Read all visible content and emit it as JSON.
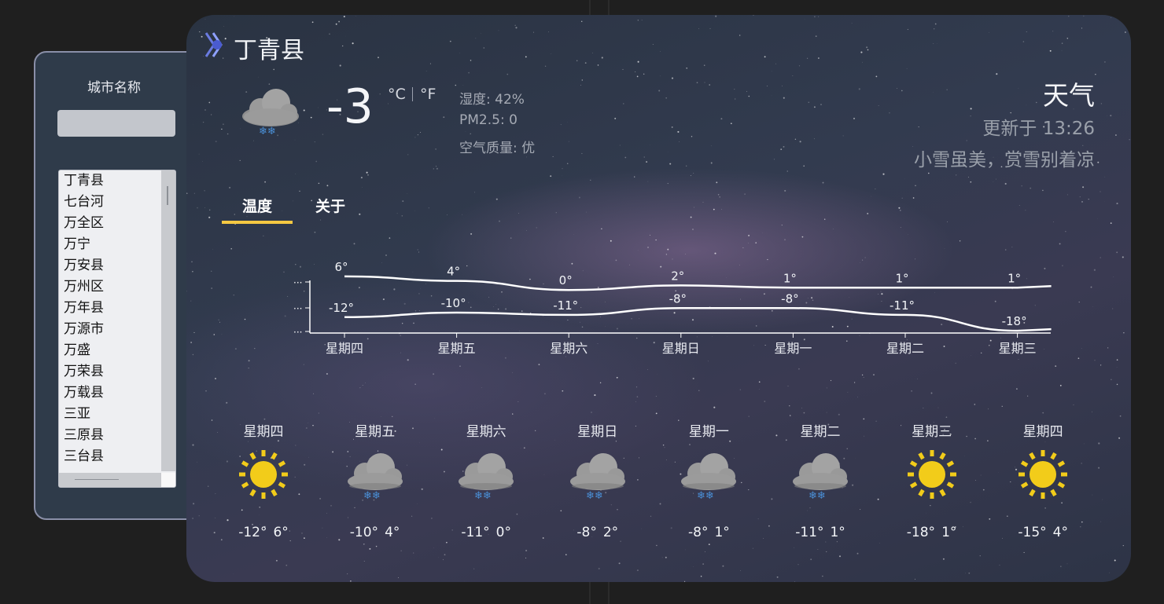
{
  "sidebar": {
    "title": "城市名称",
    "search_value": "",
    "cities": [
      "丁青县",
      "七台河",
      "万全区",
      "万宁",
      "万安县",
      "万州区",
      "万年县",
      "万源市",
      "万盛",
      "万荣县",
      "万载县",
      "三亚",
      "三原县",
      "三台县"
    ]
  },
  "header": {
    "city": "丁青县",
    "current_temp": "-3",
    "unit_c": "°C",
    "unit_f": "°F",
    "humidity": "湿度: 42%",
    "pm25": "PM2.5: 0",
    "air_quality": "空气质量: 优",
    "current_icon": "snow-cloud-icon",
    "title": "天气",
    "updated": "更新于 13:26",
    "tip": "小雪虽美，赏雪别着凉"
  },
  "tabs": [
    {
      "label": "温度",
      "active": true
    },
    {
      "label": "关于",
      "active": false
    }
  ],
  "colors": {
    "accent": "#f5c842",
    "line": "#ffffff",
    "card_bg": "#2f3749",
    "sidebar_bg": "#2f3b4a",
    "sun": "#f2cc1a",
    "snow": "#4a8fd6"
  },
  "chart_data": {
    "type": "line",
    "categories": [
      "星期四",
      "星期五",
      "星期六",
      "星期日",
      "星期一",
      "星期二",
      "星期三"
    ],
    "series": [
      {
        "values": [
          6,
          4,
          0,
          2,
          1,
          1,
          1
        ],
        "labels": [
          "6°",
          "4°",
          "0°",
          "2°",
          "1°",
          "1°",
          "1°"
        ]
      },
      {
        "values": [
          -12,
          -10,
          -11,
          -8,
          -8,
          -11,
          -18
        ],
        "labels": [
          "-12°",
          "-10°",
          "-11°",
          "-8°",
          "-8°",
          "-11°",
          "-18°"
        ]
      }
    ],
    "ylim": [
      -19,
      7
    ],
    "grid": false
  },
  "forecast": [
    {
      "day": "星期四",
      "icon": "sun-icon",
      "low": "-12°",
      "high": "6°"
    },
    {
      "day": "星期五",
      "icon": "snow-cloud-icon",
      "low": "-10°",
      "high": "4°"
    },
    {
      "day": "星期六",
      "icon": "snow-cloud-icon",
      "low": "-11°",
      "high": "0°"
    },
    {
      "day": "星期日",
      "icon": "snow-cloud-icon",
      "low": "-8°",
      "high": "2°"
    },
    {
      "day": "星期一",
      "icon": "snow-cloud-icon",
      "low": "-8°",
      "high": "1°"
    },
    {
      "day": "星期二",
      "icon": "snow-cloud-icon",
      "low": "-11°",
      "high": "1°"
    },
    {
      "day": "星期三",
      "icon": "sun-icon",
      "low": "-18°",
      "high": "1°"
    },
    {
      "day": "星期四",
      "icon": "sun-icon",
      "low": "-15°",
      "high": "4°"
    }
  ]
}
